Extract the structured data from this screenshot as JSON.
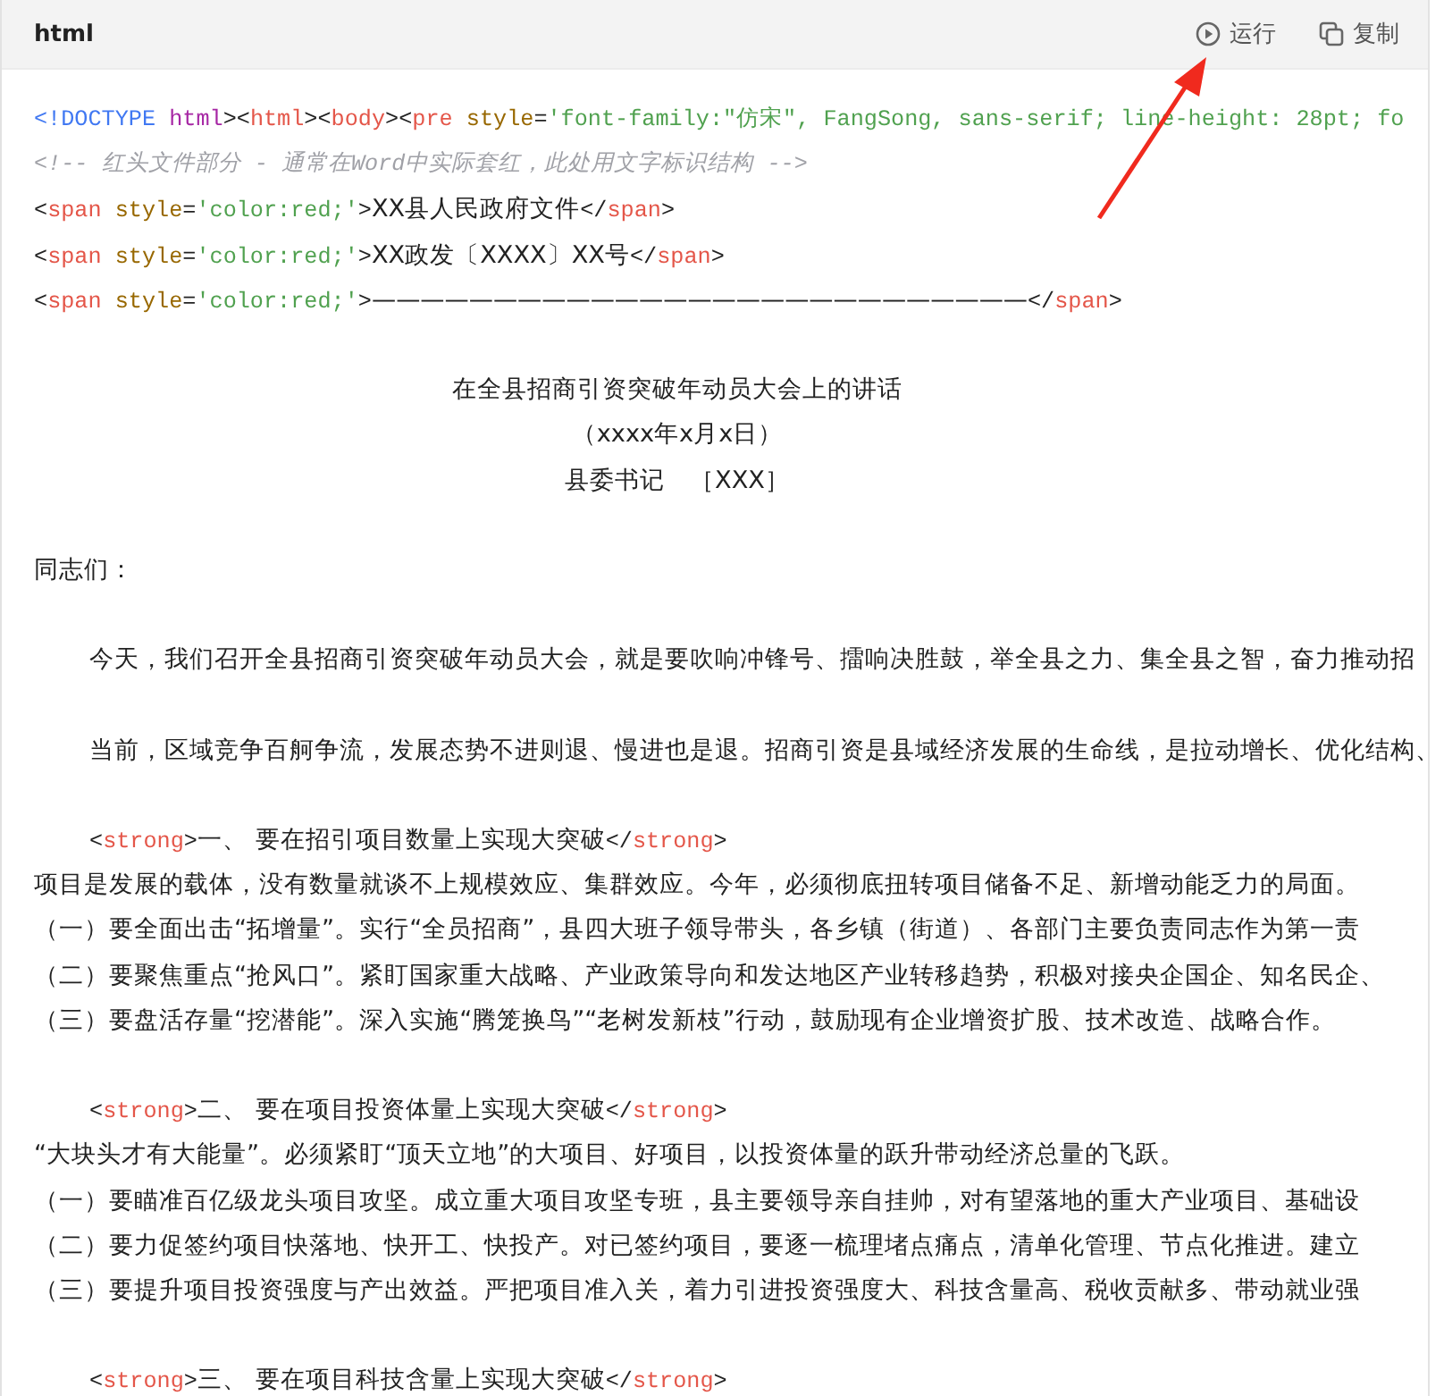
{
  "header": {
    "language": "html",
    "actions": [
      {
        "kind": "run",
        "label": "运行"
      },
      {
        "kind": "copy",
        "label": "复制"
      }
    ]
  },
  "lines": [
    {
      "kind": "code",
      "tokens": [
        {
          "kind": "doctype",
          "t": "<!DOCTYPE"
        },
        {
          "kind": "keyword",
          "t": "html"
        },
        {
          "kind": "punct",
          "t": "><"
        },
        {
          "kind": "tag",
          "t": "html"
        },
        {
          "kind": "punct",
          "t": "><"
        },
        {
          "kind": "tag",
          "t": "body"
        },
        {
          "kind": "punct",
          "t": "><"
        },
        {
          "kind": "tag",
          "t": "pre"
        },
        {
          "kind": "attr",
          "t": "style"
        },
        {
          "kind": "punct",
          "t": "="
        },
        {
          "kind": "string",
          "t": "'font-family:\"仿宋\", FangSong, sans-serif; line-height: 28pt; fo"
        }
      ]
    },
    {
      "kind": "code",
      "tokens": [
        {
          "kind": "comment",
          "t": "<!-- 红头文件部分 - 通常在Word中实际套红，此处用文字标识结构 -->"
        }
      ]
    },
    {
      "kind": "code",
      "tokens": [
        {
          "kind": "punct",
          "t": "<"
        },
        {
          "kind": "tag",
          "t": "span"
        },
        {
          "kind": "attr",
          "t": "style"
        },
        {
          "kind": "punct",
          "t": "="
        },
        {
          "kind": "string",
          "t": "'color:red;'"
        },
        {
          "kind": "punct",
          "t": ">"
        },
        {
          "kind": "text",
          "t": "XX县人民政府文件"
        },
        {
          "kind": "punct",
          "t": "</"
        },
        {
          "kind": "tag",
          "t": "span"
        },
        {
          "kind": "punct",
          "t": ">"
        }
      ]
    },
    {
      "kind": "code",
      "tokens": [
        {
          "kind": "punct",
          "t": "<"
        },
        {
          "kind": "tag",
          "t": "span"
        },
        {
          "kind": "attr",
          "t": "style"
        },
        {
          "kind": "punct",
          "t": "="
        },
        {
          "kind": "string",
          "t": "'color:red;'"
        },
        {
          "kind": "punct",
          "t": ">"
        },
        {
          "kind": "text",
          "t": "XX政发〔XXXX〕XX号"
        },
        {
          "kind": "punct",
          "t": "</"
        },
        {
          "kind": "tag",
          "t": "span"
        },
        {
          "kind": "punct",
          "t": ">"
        }
      ]
    },
    {
      "kind": "code",
      "tokens": [
        {
          "kind": "punct",
          "t": "<"
        },
        {
          "kind": "tag",
          "t": "span"
        },
        {
          "kind": "attr",
          "t": "style"
        },
        {
          "kind": "punct",
          "t": "="
        },
        {
          "kind": "string",
          "t": "'color:red;'"
        },
        {
          "kind": "punct",
          "t": ">"
        },
        {
          "kind": "text",
          "t": "———————————————————————————"
        },
        {
          "kind": "punct",
          "t": "</"
        },
        {
          "kind": "tag",
          "t": "span"
        },
        {
          "kind": "punct",
          "t": ">"
        }
      ]
    },
    {
      "kind": "blank"
    },
    {
      "kind": "center",
      "tokens": [
        {
          "kind": "text",
          "t": "在全县招商引资突破年动员大会上的讲话"
        }
      ]
    },
    {
      "kind": "center",
      "tokens": [
        {
          "kind": "text",
          "t": "（xxxx年x月x日）"
        }
      ]
    },
    {
      "kind": "center",
      "tokens": [
        {
          "kind": "text",
          "t": "县委书记　［XXX］"
        }
      ]
    },
    {
      "kind": "blank"
    },
    {
      "kind": "code",
      "tokens": [
        {
          "kind": "text",
          "t": "同志们："
        }
      ]
    },
    {
      "kind": "blank"
    },
    {
      "kind": "indent",
      "tokens": [
        {
          "kind": "text",
          "t": "今天，我们召开全县招商引资突破年动员大会，就是要吹响冲锋号、擂响决胜鼓，举全县之力、集全县之智，奋力推动招"
        }
      ]
    },
    {
      "kind": "blank"
    },
    {
      "kind": "indent",
      "tokens": [
        {
          "kind": "text",
          "t": "当前，区域竞争百舸争流，发展态势不进则退、慢进也是退。招商引资是县域经济发展的生命线，是拉动增长、优化结构、"
        }
      ]
    },
    {
      "kind": "blank"
    },
    {
      "kind": "indent",
      "tokens": [
        {
          "kind": "punct",
          "t": "<"
        },
        {
          "kind": "tag",
          "t": "strong"
        },
        {
          "kind": "punct",
          "t": ">"
        },
        {
          "kind": "text",
          "t": "一、 要在招引项目数量上实现大突破"
        },
        {
          "kind": "punct",
          "t": "</"
        },
        {
          "kind": "tag",
          "t": "strong"
        },
        {
          "kind": "punct",
          "t": ">"
        }
      ]
    },
    {
      "kind": "code",
      "tokens": [
        {
          "kind": "text",
          "t": "项目是发展的载体，没有数量就谈不上规模效应、集群效应。今年，必须彻底扭转项目储备不足、新增动能乏力的局面。"
        }
      ]
    },
    {
      "kind": "code",
      "tokens": [
        {
          "kind": "text",
          "t": "（一）要全面出击“拓增量”。实行“全员招商”，县四大班子领导带头，各乡镇（街道）、各部门主要负责同志作为第一责"
        }
      ]
    },
    {
      "kind": "code",
      "tokens": [
        {
          "kind": "text",
          "t": "（二）要聚焦重点“抢风口”。紧盯国家重大战略、产业政策导向和发达地区产业转移趋势，积极对接央企国企、知名民企、"
        }
      ]
    },
    {
      "kind": "code",
      "tokens": [
        {
          "kind": "text",
          "t": "（三）要盘活存量“挖潜能”。深入实施“腾笼换鸟”“老树发新枝”行动，鼓励现有企业增资扩股、技术改造、战略合作。"
        }
      ]
    },
    {
      "kind": "blank"
    },
    {
      "kind": "indent",
      "tokens": [
        {
          "kind": "punct",
          "t": "<"
        },
        {
          "kind": "tag",
          "t": "strong"
        },
        {
          "kind": "punct",
          "t": ">"
        },
        {
          "kind": "text",
          "t": "二、 要在项目投资体量上实现大突破"
        },
        {
          "kind": "punct",
          "t": "</"
        },
        {
          "kind": "tag",
          "t": "strong"
        },
        {
          "kind": "punct",
          "t": ">"
        }
      ]
    },
    {
      "kind": "code",
      "tokens": [
        {
          "kind": "text",
          "t": "“大块头才有大能量”。必须紧盯“顶天立地”的大项目、好项目，以投资体量的跃升带动经济总量的飞跃。"
        }
      ]
    },
    {
      "kind": "code",
      "tokens": [
        {
          "kind": "text",
          "t": "（一）要瞄准百亿级龙头项目攻坚。成立重大项目攻坚专班，县主要领导亲自挂帅，对有望落地的重大产业项目、基础设"
        }
      ]
    },
    {
      "kind": "code",
      "tokens": [
        {
          "kind": "text",
          "t": "（二）要力促签约项目快落地、快开工、快投产。对已签约项目，要逐一梳理堵点痛点，清单化管理、节点化推进。建立"
        }
      ]
    },
    {
      "kind": "code",
      "tokens": [
        {
          "kind": "text",
          "t": "（三）要提升项目投资强度与产出效益。严把项目准入关，着力引进投资强度大、科技含量高、税收贡献多、带动就业强"
        }
      ]
    },
    {
      "kind": "blank"
    },
    {
      "kind": "indent",
      "tokens": [
        {
          "kind": "punct",
          "t": "<"
        },
        {
          "kind": "tag",
          "t": "strong"
        },
        {
          "kind": "punct",
          "t": ">"
        },
        {
          "kind": "text",
          "t": "三、 要在项目科技含量上实现大突破"
        },
        {
          "kind": "punct",
          "t": "</"
        },
        {
          "kind": "tag",
          "t": "strong"
        },
        {
          "kind": "punct",
          "t": ">"
        }
      ]
    }
  ]
}
